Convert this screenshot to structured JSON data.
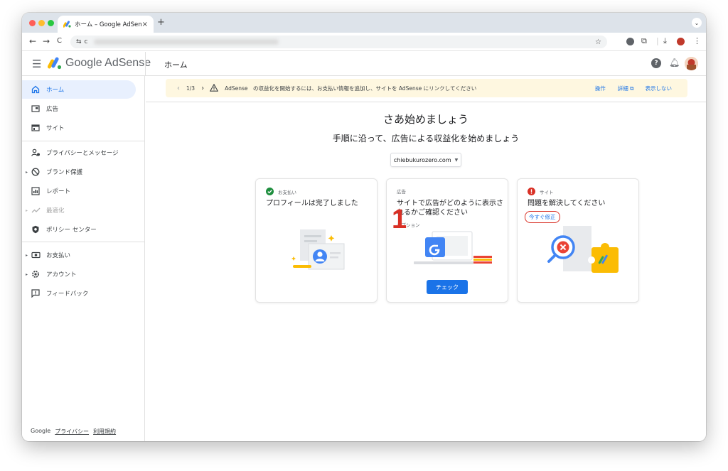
{
  "browser": {
    "tab_title": "ホーム – Google AdSense",
    "tab_close": "×",
    "new_tab": "+",
    "tab_menu": "⌄",
    "nav_back": "←",
    "nav_forward": "→",
    "nav_reload": "C",
    "url_prefix_icon": "⇆",
    "url_start": "c"
  },
  "header": {
    "product_name": "Google AdSense",
    "page_title": "ホーム",
    "help_label": "?"
  },
  "sidebar": {
    "items": [
      {
        "label": "ホーム",
        "icon": "home-icon"
      },
      {
        "label": "広告",
        "icon": "ads-icon"
      },
      {
        "label": "サイト",
        "icon": "sites-icon"
      },
      {
        "label": "プライバシーとメッセージ",
        "icon": "privacy-icon"
      },
      {
        "label": "ブランド保護",
        "icon": "block-icon"
      },
      {
        "label": "レポート",
        "icon": "reports-icon"
      },
      {
        "label": "最適化",
        "icon": "optimize-icon"
      },
      {
        "label": "ポリシー センター",
        "icon": "policy-icon"
      },
      {
        "label": "お支払い",
        "icon": "payments-icon"
      },
      {
        "label": "アカウント",
        "icon": "account-icon"
      },
      {
        "label": "フィードバック",
        "icon": "feedback-icon"
      }
    ],
    "footer": {
      "brand": "Google",
      "privacy": "プライバシー",
      "terms": "利用規約"
    }
  },
  "banner": {
    "counter": "1/3",
    "message": "AdSense　の収益化を開始するには、お支払い情報を追加し、サイトを AdSense にリンクしてください",
    "action": "操作",
    "details": "詳細",
    "dismiss": "表示しない"
  },
  "main": {
    "heading": "さあ始めましょう",
    "subheading": "手順に沿って、広告による収益化を始めましょう",
    "site_select": "chiebukurozero.com",
    "annotation_number": "1"
  },
  "cards": [
    {
      "tag": "お支払い",
      "title": "プロフィールは完了しました",
      "status": "done"
    },
    {
      "tag": "広告",
      "title": "サイトで広告がどのように表示されるかご確認ください",
      "optional": "オプション",
      "button": "チェック"
    },
    {
      "tag": "サイト",
      "title": "問題を解決してください",
      "link": "今すぐ修正",
      "status": "error"
    }
  ],
  "colors": {
    "accent": "#1a73e8",
    "error": "#d93025",
    "success": "#1e8e3e",
    "banner_bg": "#fef7e0",
    "active_nav_bg": "#e8f0fe"
  }
}
